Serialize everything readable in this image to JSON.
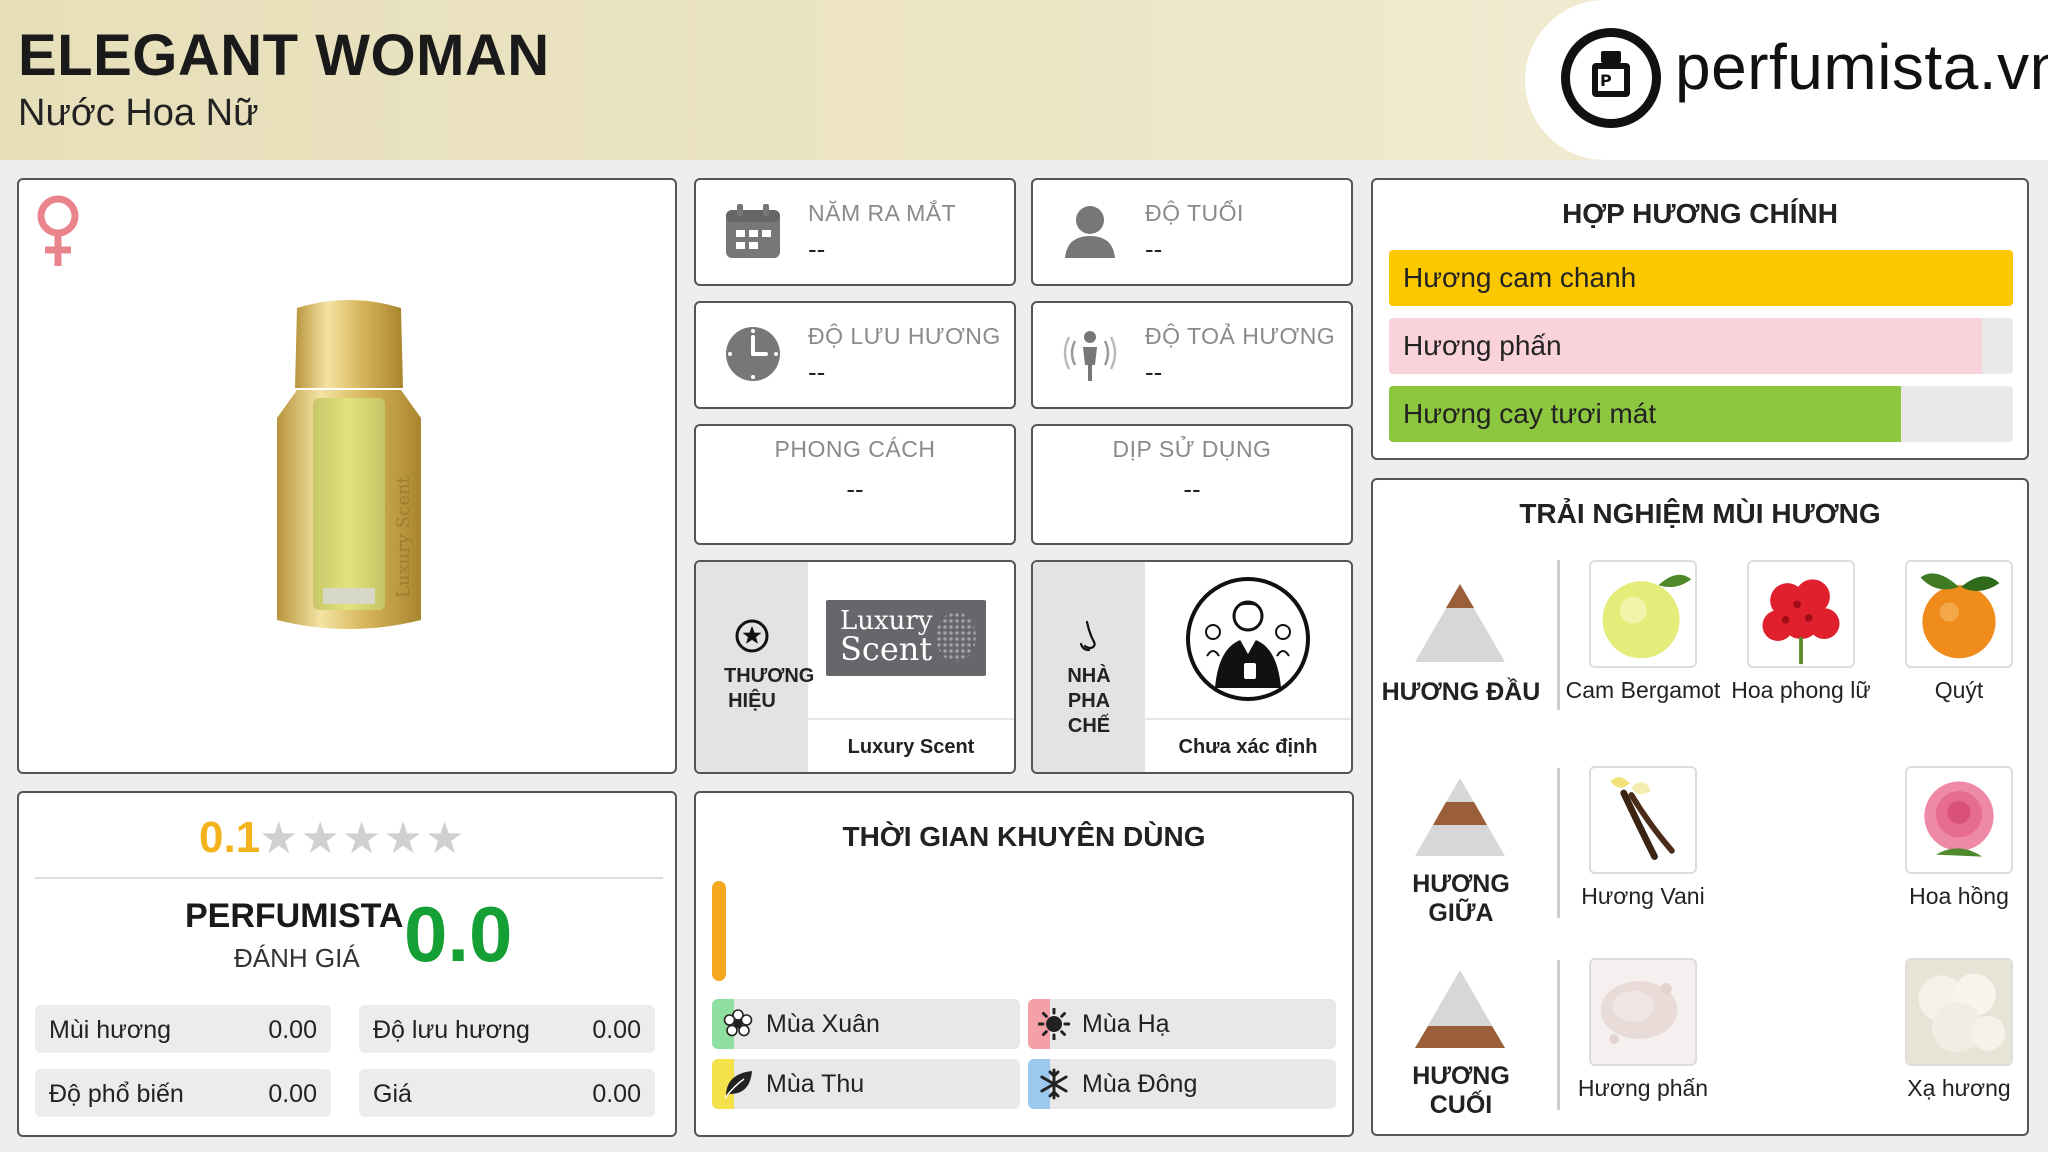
{
  "header": {
    "title": "ELEGANT WOMAN",
    "subtitle": "Nước Hoa Nữ",
    "logo_text": "perfumista.vn",
    "logo_icon": "perfume-bottle-logo-icon"
  },
  "product": {
    "gender_icon": "female-icon",
    "bottle_label": "Luxury Scent"
  },
  "rating": {
    "user_score": "0.1",
    "stars_max": 5,
    "perfumista_label": "PERFUMISTA",
    "perfumista_sub": "ĐÁNH GIÁ",
    "perfumista_score": "0.0",
    "metrics": [
      {
        "label": "Mùi hương",
        "value": "0.00"
      },
      {
        "label": "Độ lưu hương",
        "value": "0.00"
      },
      {
        "label": "Độ phổ biến",
        "value": "0.00"
      },
      {
        "label": "Giá",
        "value": "0.00"
      }
    ]
  },
  "info": {
    "launch": {
      "label": "NĂM RA MẮT",
      "value": "--",
      "icon": "calendar-icon"
    },
    "age": {
      "label": "ĐỘ TUỔI",
      "value": "--",
      "icon": "person-icon"
    },
    "longevity": {
      "label": "ĐỘ LƯU HƯƠNG",
      "value": "--",
      "icon": "clock-icon"
    },
    "sillage": {
      "label": "ĐỘ TOẢ HƯƠNG",
      "value": "--",
      "icon": "radiating-person-icon"
    },
    "style": {
      "label": "PHONG CÁCH",
      "value": "--"
    },
    "occasion": {
      "label": "DỊP SỬ DỤNG",
      "value": "--"
    }
  },
  "brand": {
    "label": "THƯƠNG HIỆU",
    "icon": "star-circle-icon",
    "logo_line1": "Luxury",
    "logo_line2": "Scent",
    "name": "Luxury Scent"
  },
  "perfumer": {
    "label": "NHÀ PHA CHẾ",
    "icon": "nose-icon",
    "name": "Chưa xác định"
  },
  "time": {
    "title": "THỜI GIAN KHUYÊN DÙNG",
    "seasons": [
      {
        "label": "Mùa Xuân",
        "icon": "flower-icon",
        "color": "#8fe0a0"
      },
      {
        "label": "Mùa Hạ",
        "icon": "sun-icon",
        "color": "#f5a0a8"
      },
      {
        "label": "Mùa Thu",
        "icon": "leaf-icon",
        "color": "#f5e14a"
      },
      {
        "label": "Mùa Đông",
        "icon": "snowflake-icon",
        "color": "#9cc8f0"
      }
    ]
  },
  "accords": {
    "title": "HỢP HƯƠNG CHÍNH",
    "items": [
      {
        "label": "Hương cam chanh",
        "color": "#fcc800",
        "level": 1.0
      },
      {
        "label": "Hương phấn",
        "color": "#f9d2db",
        "level": 0.95
      },
      {
        "label": "Hương cay tươi mát",
        "color": "#8dc63f",
        "level": 0.82
      }
    ]
  },
  "notes": {
    "title": "TRẢI NGHIỆM MÙI HƯƠNG",
    "top": {
      "label": "HƯƠNG ĐẦU",
      "items": [
        {
          "label": "Cam Bergamot",
          "icon": "bergamot-icon"
        },
        {
          "label": "Hoa phong lữ",
          "icon": "geranium-icon"
        },
        {
          "label": "Quýt",
          "icon": "mandarin-icon"
        }
      ]
    },
    "middle": {
      "label": "HƯƠNG GIỮA",
      "items": [
        {
          "label": "Hương Vani",
          "icon": "vanilla-icon"
        },
        {
          "label": "Hoa hồng",
          "icon": "rose-icon"
        }
      ]
    },
    "base": {
      "label": "HƯƠNG CUỐI",
      "items": [
        {
          "label": "Hương phấn",
          "icon": "powder-icon"
        },
        {
          "label": "Xạ hương",
          "icon": "musk-icon"
        }
      ]
    }
  }
}
